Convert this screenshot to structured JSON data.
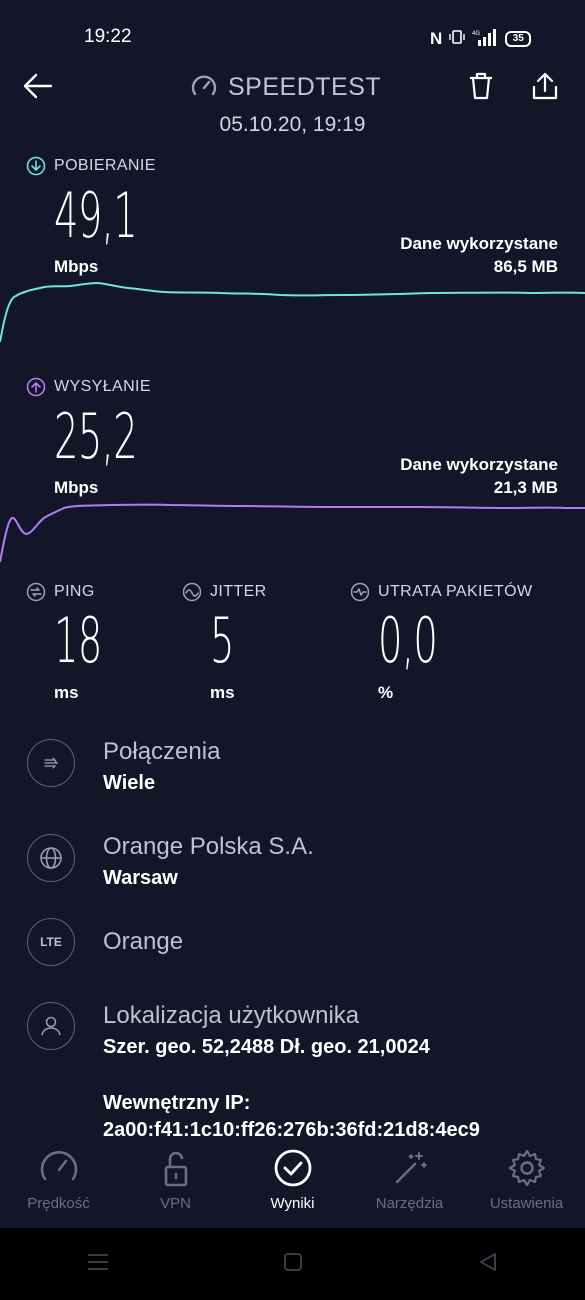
{
  "status_bar": {
    "time": "19:22",
    "nfc": "N",
    "battery": "35",
    "network": "4G"
  },
  "header": {
    "title": "SPEEDTEST",
    "date": "05.10.20, 19:19"
  },
  "download": {
    "label": "POBIERANIE",
    "value": "49,1",
    "unit": "Mbps",
    "data_used_label": "Dane wykorzystane",
    "data_used_value": "86,5 MB",
    "color": "#6fe3e1"
  },
  "upload": {
    "label": "WYSYŁANIE",
    "value": "25,2",
    "unit": "Mbps",
    "data_used_label": "Dane wykorzystane",
    "data_used_value": "21,3 MB",
    "color": "#b27cf0"
  },
  "ping": {
    "label": "PING",
    "value": "18",
    "unit": "ms"
  },
  "jitter": {
    "label": "JITTER",
    "value": "5",
    "unit": "ms"
  },
  "packet_loss": {
    "label": "UTRATA PAKIETÓW",
    "value": "0,0",
    "unit": "%"
  },
  "connections": {
    "title": "Połączenia",
    "value": "Wiele"
  },
  "provider": {
    "title": "Orange Polska S.A.",
    "value": "Warsaw"
  },
  "network": {
    "badge": "LTE",
    "title": "Orange"
  },
  "location": {
    "title": "Lokalizacja użytkownika",
    "value": "Szer. geo. 52,2488 Dł. geo. 21,0024"
  },
  "internal_ip": {
    "label": "Wewnętrzny IP:",
    "value": "2a00:f41:1c10:ff26:276b:36fd:21d8:4ec9"
  },
  "nav": [
    {
      "label": "Prędkość",
      "icon": "speedometer-icon"
    },
    {
      "label": "VPN",
      "icon": "lock-icon"
    },
    {
      "label": "Wyniki",
      "icon": "check-circle-icon"
    },
    {
      "label": "Narzędzia",
      "icon": "wand-icon"
    },
    {
      "label": "Ustawienia",
      "icon": "gear-icon"
    }
  ]
}
